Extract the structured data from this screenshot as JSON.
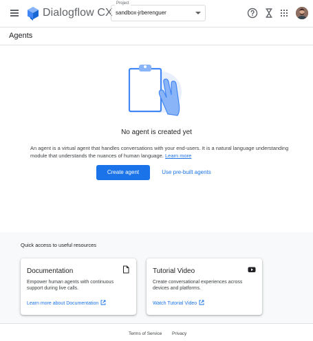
{
  "app": {
    "title": "Dialogflow CX"
  },
  "project": {
    "label": "Project",
    "value": "sandbox-jrberenguer"
  },
  "topbar_icons": [
    "help-icon",
    "hourglass-icon",
    "apps-grid-icon",
    "avatar"
  ],
  "page": {
    "title": "Agents"
  },
  "empty_state": {
    "title": "No agent is created yet",
    "description": "An agent is a virtual agent that handles conversations with your end-users. It is a natural language understanding module that understands the nuances of human language.",
    "learn_more": "Learn more",
    "create_button": "Create agent",
    "prebuilt_button": "Use pre-built agents"
  },
  "resources": {
    "title": "Quick access to useful resources",
    "cards": [
      {
        "title": "Documentation",
        "description": "Empower human agents with continuous support during live calls.",
        "link": "Learn more about Documentation",
        "icon": "document-icon"
      },
      {
        "title": "Tutorial Video",
        "description": "Create conversational experiences across devices and platforms.",
        "link": "Watch Tutorial Video",
        "icon": "youtube-icon"
      }
    ]
  },
  "footer": {
    "terms": "Terms of Service",
    "privacy": "Privacy"
  },
  "colors": {
    "primary": "#1a73e8",
    "text": "#202124",
    "secondary_text": "#5f6368",
    "surface": "#f8f9fa"
  }
}
